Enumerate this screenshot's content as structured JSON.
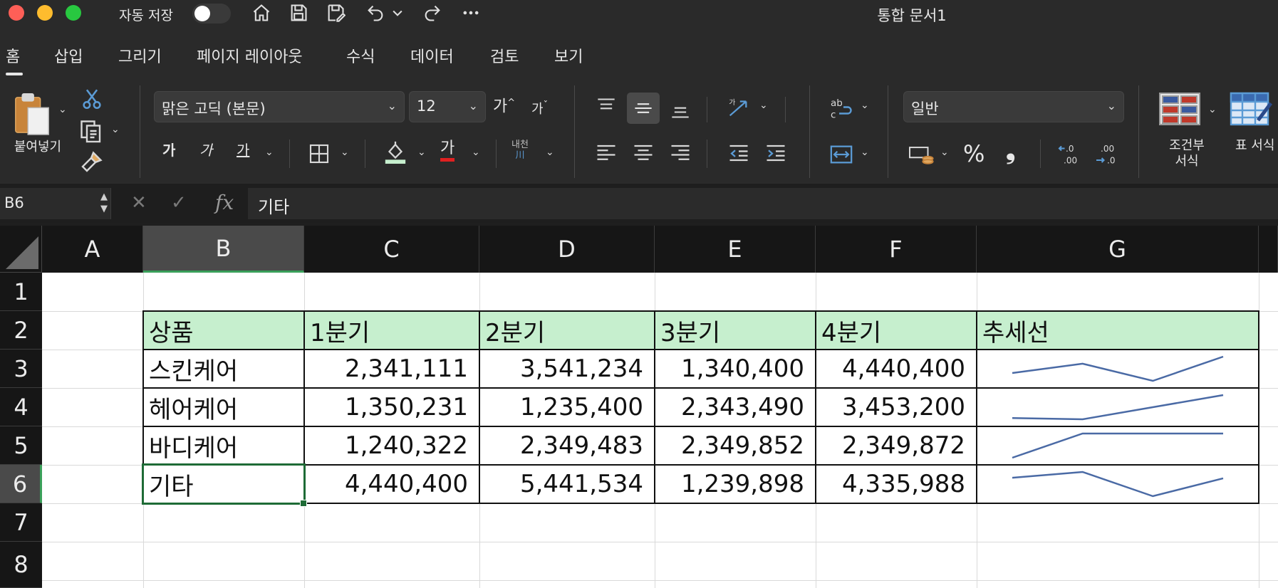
{
  "titlebar": {
    "autosave_label": "자동 저장",
    "doc_title": "통합 문서1"
  },
  "ribbon_tabs": [
    "홈",
    "삽입",
    "그리기",
    "페이지 레이아웃",
    "수식",
    "데이터",
    "검토",
    "보기"
  ],
  "ribbon": {
    "paste_label": "붙여넣기",
    "font_name": "맑은 고딕 (본문)",
    "font_size": "12",
    "grow_font": "가",
    "shrink_font": "가",
    "bold": "가",
    "italic": "가",
    "underline": "가",
    "font_color_glyph": "가",
    "phonetic_top": "내천",
    "phonetic_bottom": "川",
    "number_format": "일반",
    "percent": "%",
    "comma": "❟",
    "conditional_format_label_1": "조건부",
    "conditional_format_label_2": "서식",
    "table_format_label": "표 서식",
    "fill_color": "#c6efce",
    "font_color": "#e02020"
  },
  "formula_bar": {
    "name_box": "B6",
    "formula": "기타"
  },
  "sheet": {
    "columns": [
      "A",
      "B",
      "C",
      "D",
      "E",
      "F",
      "G"
    ],
    "rows": [
      "1",
      "2",
      "3",
      "4",
      "5",
      "6",
      "7",
      "8"
    ],
    "active_cell": "B6",
    "header_fill": "#c6efce",
    "table": {
      "headers": [
        "상품",
        "1분기",
        "2분기",
        "3분기",
        "4분기",
        "추세선"
      ],
      "rows": [
        {
          "product": "스킨케어",
          "values": [
            "2,341,111",
            "3,541,234",
            "1,340,400",
            "4,440,400"
          ],
          "trend": [
            2341111,
            3541234,
            1340400,
            4440400
          ]
        },
        {
          "product": "헤어케어",
          "values": [
            "1,350,231",
            "1,235,400",
            "2,343,490",
            "3,453,200"
          ],
          "trend": [
            1350231,
            1235400,
            2343490,
            3453200
          ]
        },
        {
          "product": "바디케어",
          "values": [
            "1,240,322",
            "2,349,483",
            "2,349,852",
            "2,349,872"
          ],
          "trend": [
            1240322,
            2349483,
            2349852,
            2349872
          ]
        },
        {
          "product": "기타",
          "values": [
            "4,440,400",
            "5,441,534",
            "1,239,898",
            "4,335,988"
          ],
          "trend": [
            4440400,
            5441534,
            1239898,
            4335988
          ]
        }
      ]
    },
    "sparkline_color": "#4a6aa5"
  }
}
